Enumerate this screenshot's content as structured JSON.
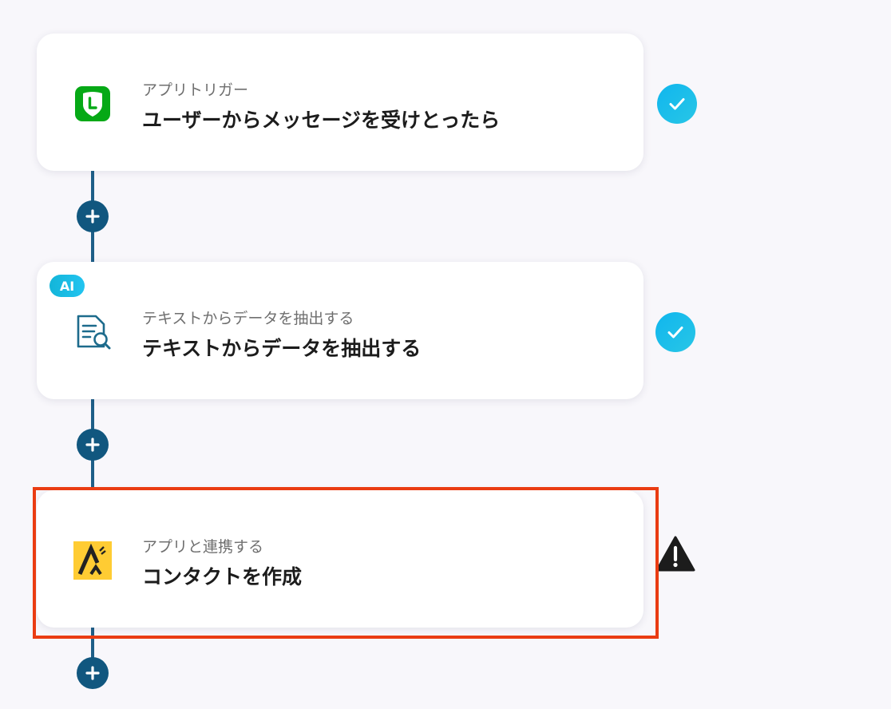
{
  "steps": [
    {
      "subtitle": "アプリトリガー",
      "title": "ユーザーからメッセージを受けとったら",
      "icon": "line-app-icon",
      "status": "complete"
    },
    {
      "badge": "AI",
      "subtitle": "テキストからデータを抽出する",
      "title": "テキストからデータを抽出する",
      "icon": "document-search-icon",
      "status": "complete"
    },
    {
      "subtitle": "アプリと連携する",
      "title": "コンタクトを作成",
      "icon": "app-logo-icon",
      "status": "warning"
    }
  ],
  "colors": {
    "connector": "#1e5f88",
    "add_button": "#11577f",
    "check": "#10b6ee",
    "highlight": "#ea3c12",
    "line_green": "#06a916",
    "app_yellow": "#ffcc33"
  },
  "icons": {
    "add": "plus-icon",
    "complete": "checkmark-icon",
    "warning": "warning-triangle-icon"
  }
}
